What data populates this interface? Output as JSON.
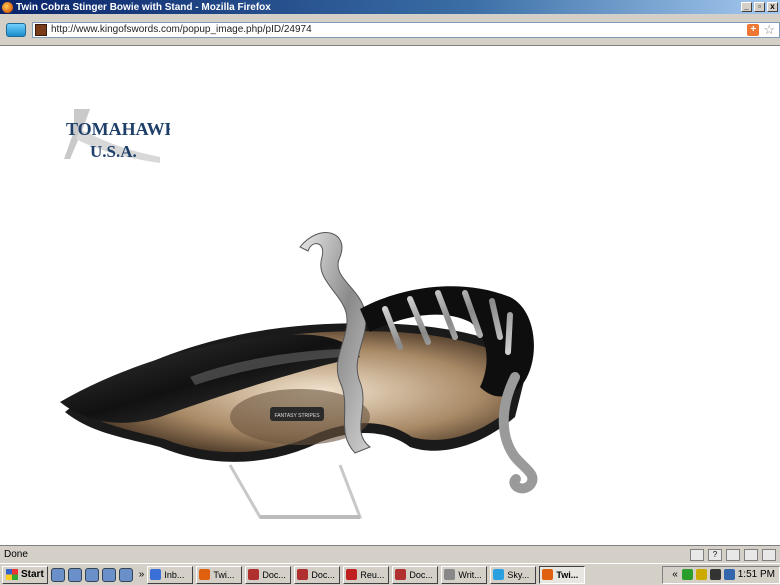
{
  "window": {
    "title": "Twin Cobra Stinger Bowie with Stand - Mozilla Firefox",
    "controls": {
      "minimize": "_",
      "maximize": "▫",
      "close": "x"
    }
  },
  "address_bar": {
    "url": "http://www.kingofswords.com/popup_image.php/pID/24974"
  },
  "content": {
    "logo_main": "TOMAHAWK",
    "logo_sub": "U.S.A.",
    "blade_badge": "FANTASY STRIPES"
  },
  "status": {
    "text": "Done"
  },
  "taskbar": {
    "start_label": "Start",
    "quicklaunch_chevron": "»",
    "buttons": [
      {
        "label": "Inb...",
        "icon": "ie-icon",
        "color": "#3a6fd8"
      },
      {
        "label": "Twi...",
        "icon": "firefox-icon",
        "color": "#e06010"
      },
      {
        "label": "Doc...",
        "icon": "document-icon",
        "color": "#b03030"
      },
      {
        "label": "Doc...",
        "icon": "document-icon",
        "color": "#b03030"
      },
      {
        "label": "Reu...",
        "icon": "feather-icon",
        "color": "#c02020"
      },
      {
        "label": "Doc...",
        "icon": "document-icon",
        "color": "#b03030"
      },
      {
        "label": "Writ...",
        "icon": "writer-icon",
        "color": "#888888"
      },
      {
        "label": "Sky...",
        "icon": "skype-icon",
        "color": "#2aa0e0"
      },
      {
        "label": "Twi...",
        "icon": "firefox-icon",
        "color": "#e06010",
        "active": true
      }
    ],
    "tray_chevron": "«",
    "clock": "1:51 PM"
  }
}
